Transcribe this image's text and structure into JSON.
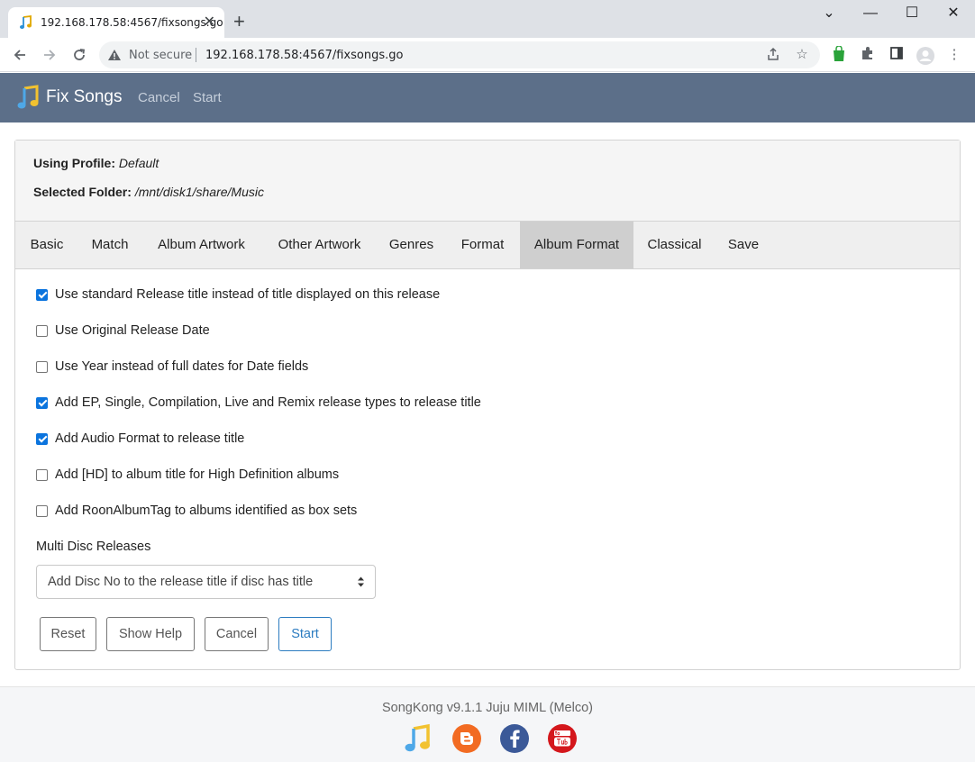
{
  "browser": {
    "tab_title": "192.168.178.58:4567/fixsongs.go",
    "tab_close": "✕",
    "new_tab": "+",
    "security_label": "Not secure",
    "url": "192.168.178.58:4567/fixsongs.go",
    "window": {
      "minimize": "⌄",
      "restore": "—",
      "maximize": "☐",
      "close": "✕"
    }
  },
  "app": {
    "title": "Fix Songs",
    "nav": [
      "Cancel",
      "Start"
    ]
  },
  "profile": {
    "profile_label": "Using Profile:",
    "profile_value": "Default",
    "folder_label": "Selected Folder:",
    "folder_value": "/mnt/disk1/share/Music"
  },
  "tabs": [
    {
      "label": "Basic",
      "active": false
    },
    {
      "label": "Match",
      "active": false
    },
    {
      "label": "Album Artwork",
      "active": false
    },
    {
      "label": "Other Artwork",
      "active": false
    },
    {
      "label": "Genres",
      "active": false
    },
    {
      "label": "Format",
      "active": false
    },
    {
      "label": "Album Format",
      "active": true
    },
    {
      "label": "Classical",
      "active": false
    },
    {
      "label": "Save",
      "active": false
    }
  ],
  "options": [
    {
      "label": "Use standard Release title instead of title displayed on this release",
      "checked": true
    },
    {
      "label": "Use Original Release Date",
      "checked": false
    },
    {
      "label": "Use Year instead of full dates for Date fields",
      "checked": false
    },
    {
      "label": "Add EP, Single, Compilation, Live and Remix release types to release title",
      "checked": true
    },
    {
      "label": "Add Audio Format to release title",
      "checked": true
    },
    {
      "label": "Add [HD] to album title for High Definition albums",
      "checked": false
    },
    {
      "label": "Add RoonAlbumTag to albums identified as box sets",
      "checked": false
    }
  ],
  "multi_disc": {
    "label": "Multi Disc Releases",
    "selected": "Add Disc No to the release title if disc has title"
  },
  "buttons": {
    "reset": "Reset",
    "show_help": "Show Help",
    "cancel": "Cancel",
    "start": "Start"
  },
  "footer": {
    "version": "SongKong v9.1.1 Juju MIML (Melco)"
  },
  "colors": {
    "appbar": "#5c6f89",
    "accent": "#2c7cc0",
    "checkbox": "#0b74de",
    "active_tab": "#cfcfcf"
  }
}
